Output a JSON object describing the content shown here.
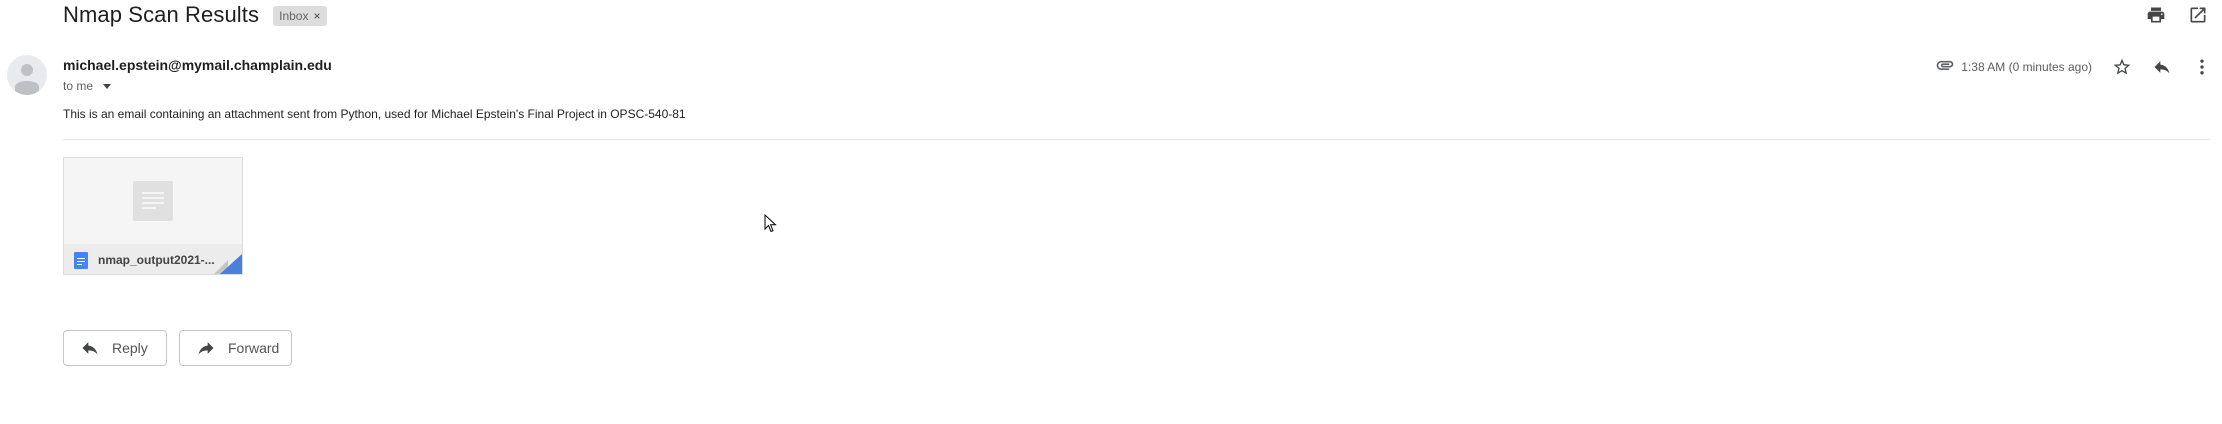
{
  "email": {
    "subject": "Nmap Scan Results",
    "label": "Inbox",
    "label_remove": "×",
    "sender_email": "michael.epstein@mymail.champlain.edu",
    "recipient": "to me",
    "timestamp": "1:38 AM (0 minutes ago)",
    "body": "This is an email containing an attachment sent from Python, used for Michael Epstein's Final Project in OPSC-540-81"
  },
  "attachment": {
    "file_name": "nmap_output2021-..."
  },
  "actions": {
    "reply_label": "Reply",
    "forward_label": "Forward"
  },
  "icons": {
    "print": "print-icon",
    "open_new_window": "open-in-new-window-icon",
    "attachment": "paperclip-icon",
    "star": "star-icon",
    "reply": "reply-icon",
    "more": "more-vert-icon",
    "avatar": "default-avatar-icon",
    "file": "google-doc-icon"
  },
  "colors": {
    "accent": "#4285f4",
    "label_bg": "#dddddd",
    "divider": "#e5e5e5"
  }
}
